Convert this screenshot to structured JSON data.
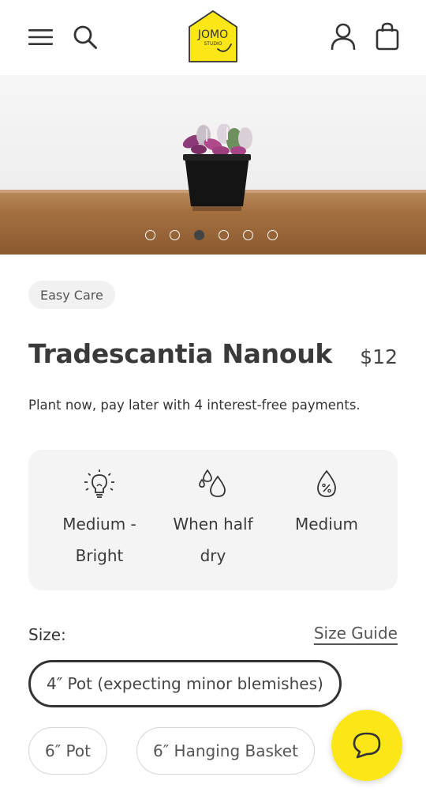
{
  "header": {
    "logo_text": "JOMO",
    "logo_subtext": "STUDIO",
    "icons": [
      "menu-icon",
      "search-icon",
      "account-icon",
      "shopping-bag-icon"
    ],
    "brand_yellow": "#fbe718"
  },
  "gallery": {
    "slide_count": 6,
    "active_index": 2
  },
  "product": {
    "badge": "Easy Care",
    "title": "Tradescantia Nanouk",
    "price": "$12",
    "pay_later": "Plant now, pay later with 4 interest-free payments."
  },
  "care": {
    "light": {
      "icon": "lightbulb-icon",
      "label_line1": "Medium -",
      "label_line2": "Bright"
    },
    "water": {
      "icon": "water-drops-icon",
      "label_line1": "When half",
      "label_line2": "dry"
    },
    "humidity": {
      "icon": "humidity-drop-icon",
      "label_line1": "Medium",
      "label_line2": ""
    }
  },
  "size": {
    "label": "Size:",
    "guide_link": "Size Guide",
    "options": [
      {
        "label": "4″ Pot (expecting minor blemishes)",
        "selected": true
      },
      {
        "label": "6″ Pot",
        "selected": false
      },
      {
        "label": "6″ Hanging Basket",
        "selected": false
      }
    ]
  },
  "chat": {
    "icon": "chat-bubble-icon"
  }
}
